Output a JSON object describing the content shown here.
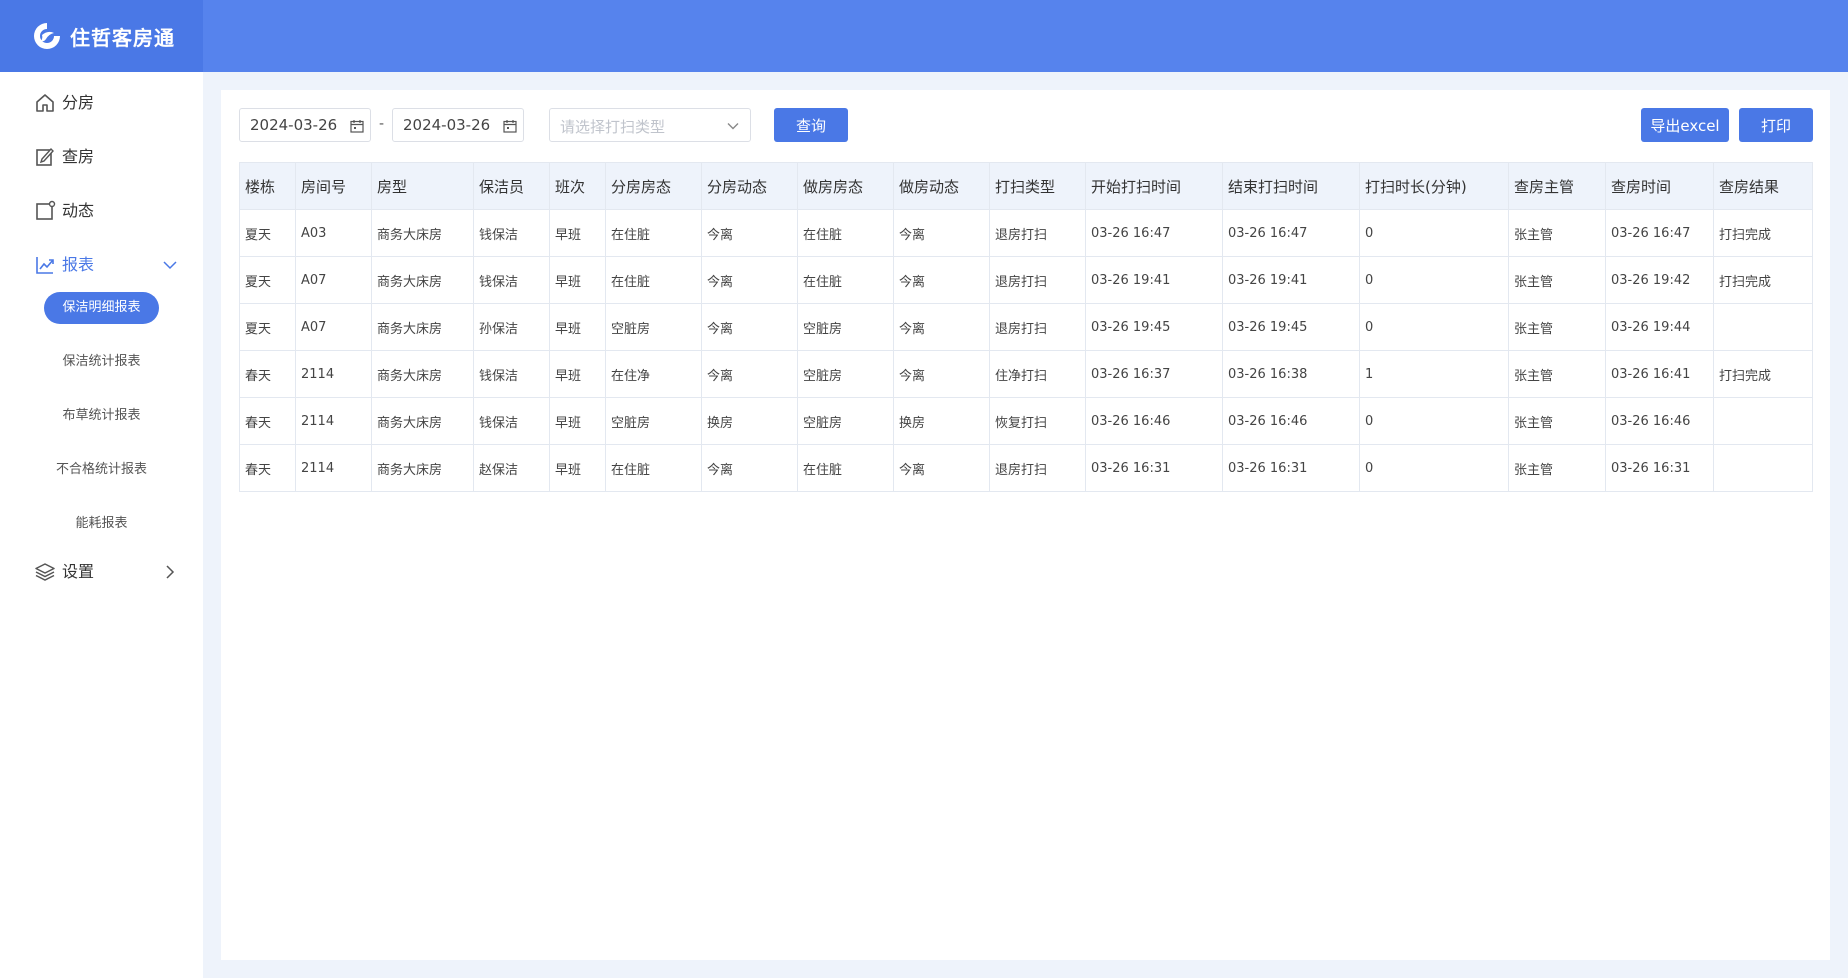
{
  "app": {
    "name": "住哲客房通"
  },
  "sidebar": {
    "items": [
      {
        "label": "分房",
        "icon": "home-icon"
      },
      {
        "label": "查房",
        "icon": "edit-icon"
      },
      {
        "label": "动态",
        "icon": "square-icon"
      },
      {
        "label": "报表",
        "icon": "chart-line-icon",
        "expanded": true
      },
      {
        "label": "设置",
        "icon": "layers-icon"
      }
    ],
    "report_subitems": [
      {
        "label": "保洁明细报表",
        "active": true
      },
      {
        "label": "保洁统计报表"
      },
      {
        "label": "布草统计报表"
      },
      {
        "label": "不合格统计报表"
      },
      {
        "label": "能耗报表"
      }
    ]
  },
  "filters": {
    "start_date": "2024-03-26",
    "separator": "-",
    "end_date": "2024-03-26",
    "clean_type_placeholder": "请选择打扫类型",
    "query_label": "查询",
    "export_label": "导出excel",
    "print_label": "打印"
  },
  "table": {
    "columns": [
      "楼栋",
      "房间号",
      "房型",
      "保洁员",
      "班次",
      "分房房态",
      "分房动态",
      "做房房态",
      "做房动态",
      "打扫类型",
      "开始打扫时间",
      "结束打扫时间",
      "打扫时长(分钟)",
      "查房主管",
      "查房时间",
      "查房结果"
    ],
    "rows": [
      [
        "夏天",
        "A03",
        "商务大床房",
        "钱保洁",
        "早班",
        "在住脏",
        "今离",
        "在住脏",
        "今离",
        "退房打扫",
        "03-26 16:47",
        "03-26 16:47",
        "0",
        "张主管",
        "03-26 16:47",
        "打扫完成"
      ],
      [
        "夏天",
        "A07",
        "商务大床房",
        "钱保洁",
        "早班",
        "在住脏",
        "今离",
        "在住脏",
        "今离",
        "退房打扫",
        "03-26 19:41",
        "03-26 19:41",
        "0",
        "张主管",
        "03-26 19:42",
        "打扫完成"
      ],
      [
        "夏天",
        "A07",
        "商务大床房",
        "孙保洁",
        "早班",
        "空脏房",
        "今离",
        "空脏房",
        "今离",
        "退房打扫",
        "03-26 19:45",
        "03-26 19:45",
        "0",
        "张主管",
        "03-26 19:44",
        ""
      ],
      [
        "春天",
        "2114",
        "商务大床房",
        "钱保洁",
        "早班",
        "在住净",
        "今离",
        "空脏房",
        "今离",
        "住净打扫",
        "03-26 16:37",
        "03-26 16:38",
        "1",
        "张主管",
        "03-26 16:41",
        "打扫完成"
      ],
      [
        "春天",
        "2114",
        "商务大床房",
        "钱保洁",
        "早班",
        "空脏房",
        "换房",
        "空脏房",
        "换房",
        "恢复打扫",
        "03-26 16:46",
        "03-26 16:46",
        "0",
        "张主管",
        "03-26 16:46",
        ""
      ],
      [
        "春天",
        "2114",
        "商务大床房",
        "赵保洁",
        "早班",
        "在住脏",
        "今离",
        "在住脏",
        "今离",
        "退房打扫",
        "03-26 16:31",
        "03-26 16:31",
        "0",
        "张主管",
        "03-26 16:31",
        ""
      ]
    ]
  },
  "colors": {
    "primary": "#4a78e6",
    "topbar": "#5683ed",
    "page_bg": "#eef3fb",
    "header_bg": "#eef3fb"
  }
}
